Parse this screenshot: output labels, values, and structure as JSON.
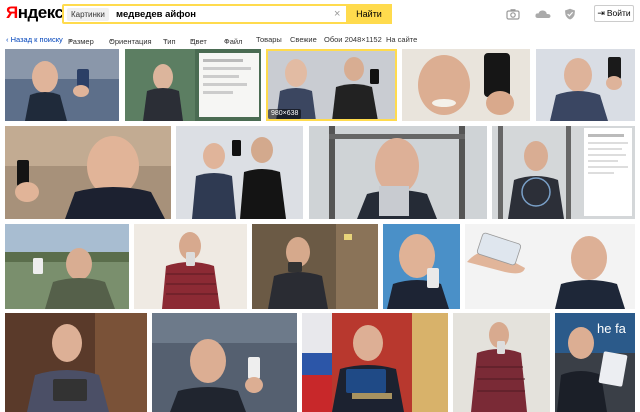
{
  "header": {
    "logo_first": "Я",
    "logo_rest": "ндекс",
    "chip_label": "Картинки",
    "query": "медведев айфон",
    "clear_symbol": "×",
    "search_button": "Найти",
    "icons": [
      "camera-icon",
      "cloud-icon",
      "shield-icon"
    ],
    "login_label": "Войти",
    "login_icon": "login-arrow-icon"
  },
  "filters": {
    "back": "‹ Назад к поиску",
    "size": "Размер",
    "orientation": "Ориентация",
    "type": "Тип",
    "color": "Цвет",
    "file": "Файл",
    "goods": "Товары",
    "fresh": "Свежие",
    "wallpaper": "Обои 2048×1152",
    "on_site": "На сайте"
  },
  "results": {
    "selected_size_badge": "980×638",
    "tiles": [
      {
        "row": 1,
        "bg": "#5d6f8a",
        "selected": false
      },
      {
        "row": 1,
        "bg": "#4a6b52",
        "selected": false
      },
      {
        "row": 1,
        "bg": "#c9ccd2",
        "selected": true
      },
      {
        "row": 1,
        "bg": "#e9e4dc",
        "selected": false
      },
      {
        "row": 1,
        "bg": "#d9dde4",
        "selected": false
      },
      {
        "row": 2,
        "bg": "#a7917a",
        "selected": false
      },
      {
        "row": 2,
        "bg": "#dcdfe4",
        "selected": false
      },
      {
        "row": 2,
        "bg": "#cfd3d6",
        "selected": false
      },
      {
        "row": 2,
        "bg": "#d4d7d9",
        "selected": false
      },
      {
        "row": 3,
        "bg": "#7a8f6d",
        "selected": false
      },
      {
        "row": 3,
        "bg": "#efeae3",
        "selected": false
      },
      {
        "row": 3,
        "bg": "#6b5a45",
        "selected": false
      },
      {
        "row": 3,
        "bg": "#4a90c8",
        "selected": false
      },
      {
        "row": 3,
        "bg": "#f3f3f3",
        "selected": false
      },
      {
        "row": 4,
        "bg": "#5a3a2a",
        "selected": false
      },
      {
        "row": 4,
        "bg": "#556070",
        "selected": false
      },
      {
        "row": 4,
        "bg": "#b8382e",
        "selected": false
      },
      {
        "row": 4,
        "bg": "#e4e2dc",
        "selected": false
      },
      {
        "row": 4,
        "bg": "#3a3f47",
        "selected": false
      }
    ],
    "overlay_text_last_tile": "he fa"
  },
  "colors": {
    "accent_yellow": "#ffdb4d",
    "logo_red": "#ff0000",
    "link_blue": "#0044bb"
  }
}
